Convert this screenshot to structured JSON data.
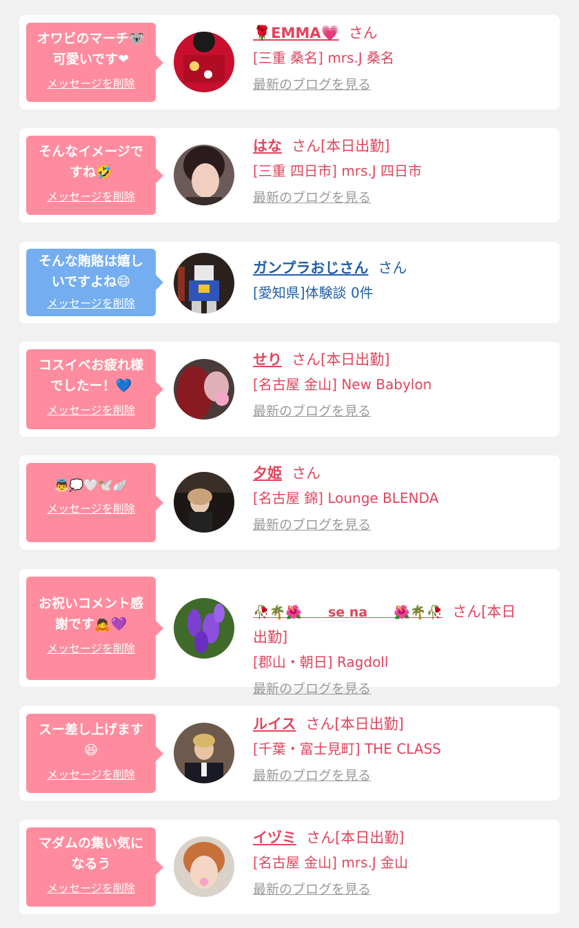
{
  "delete_label": "メッセージを削除",
  "blog_label": "最新のブログを見る",
  "messages": [
    {
      "comment": "オワビのマーチ🐨\n可愛いです❤",
      "name": "🌹EMMA💗",
      "suffix": "さん",
      "shop": "[三重 桑名] mrs.J 桑名",
      "has_blog": true,
      "bubble_color": "#ff8c9e",
      "avatar_icon": "red-jersey-photo"
    },
    {
      "comment": "そんなイメージで\nすね🤣",
      "name": "はな",
      "suffix": "さん[本日出勤]",
      "shop": "[三重 四日市] mrs.J 四日市",
      "has_blog": true,
      "bubble_color": "#ff8c9e",
      "avatar_icon": "woman-portrait-photo"
    },
    {
      "comment": "そんな賄賂は嬉し\nいですよね😄",
      "name": "ガンプラおじさん",
      "suffix": "さん",
      "shop": "[愛知県]体験談 0件",
      "has_blog": false,
      "bubble_color": "#74aef0",
      "avatar_icon": "gundam-model-photo"
    },
    {
      "comment": "コスイベお疲れ様\nでしたー！💙",
      "name": "せり",
      "suffix": "さん[本日出勤]",
      "shop": "[名古屋 金山] New Babylon",
      "has_blog": true,
      "bubble_color": "#ff8c9e",
      "avatar_icon": "red-hair-photo"
    },
    {
      "comment": "👼💭🤍🕊️🪽",
      "name": "夕姫",
      "suffix": "さん",
      "shop": "[名古屋 錦] Lounge BLENDA",
      "has_blog": true,
      "bubble_color": "#ff8c9e",
      "avatar_icon": "dark-room-portrait-photo"
    },
    {
      "comment": "お祝いコメント感\n謝です🙇💜",
      "name": "🥀🌴🌺　　se na　　🌺🌴🥀",
      "suffix": "さん[本日\n出勤]",
      "shop": "[郡山・朝日] Ragdoll",
      "has_blog": true,
      "bubble_color": "#ff8c9e",
      "avatar_icon": "purple-flowers-photo"
    },
    {
      "comment": "スー差し上げます\n😆",
      "name": "ルイス",
      "suffix": "さん[本日出勤]",
      "shop": "[千葉・富士見町] THE CLASS",
      "has_blog": true,
      "bubble_color": "#ff8c9e",
      "avatar_icon": "man-in-suit-photo"
    },
    {
      "comment": "マダムの集い気に\nなるう",
      "name": "イヅミ",
      "suffix": "さん[本日出勤]",
      "shop": "[名古屋 金山] mrs.J 金山",
      "has_blog": true,
      "bubble_color": "#ff8c9e",
      "avatar_icon": "woman-selfie-photo"
    }
  ]
}
